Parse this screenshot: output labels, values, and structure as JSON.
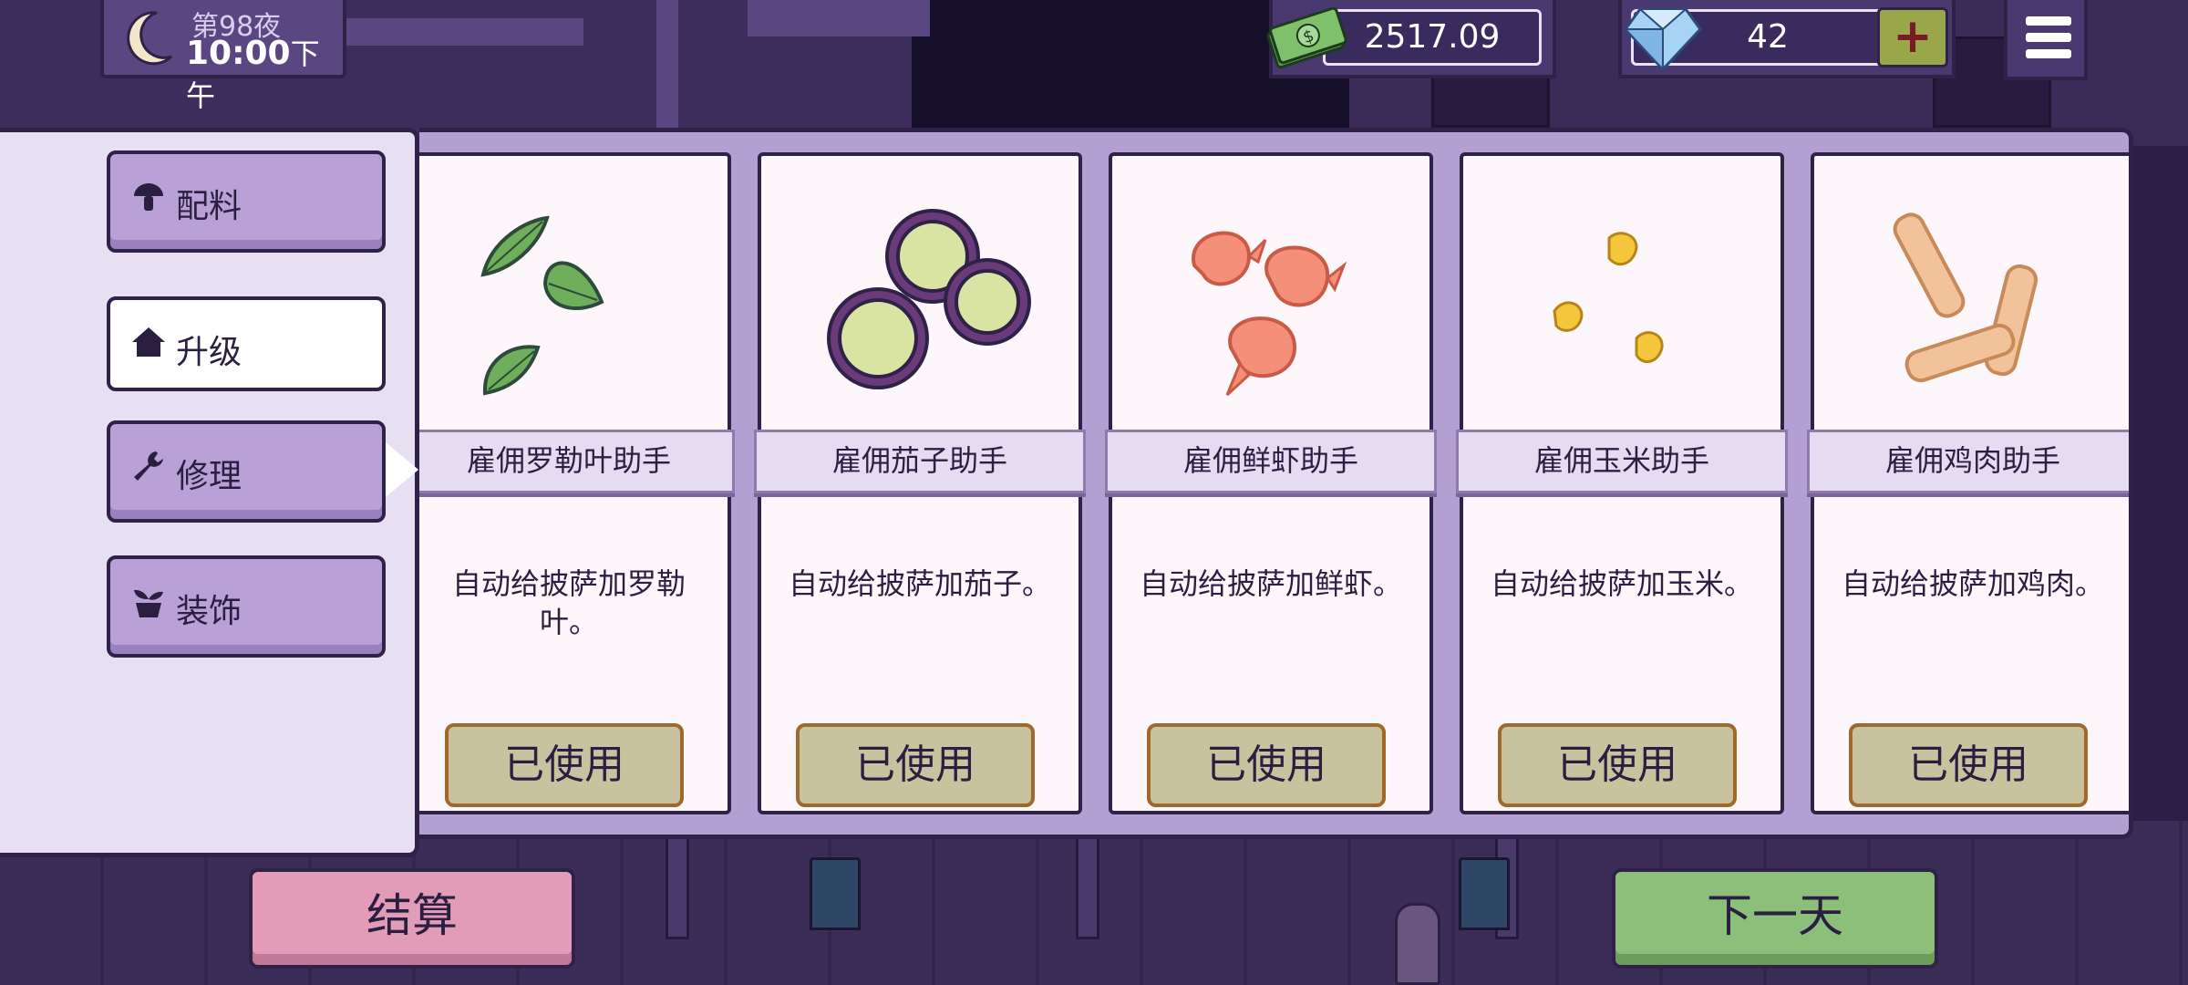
{
  "hud": {
    "night_label": "第98夜",
    "time": "10:00",
    "ampm": "下午",
    "money": "2517.09",
    "gems": "42",
    "add_gems_label": "+"
  },
  "sidebar": {
    "tabs": [
      {
        "label": "配料",
        "icon": "mushroom-icon"
      },
      {
        "label": "升级",
        "icon": "house-icon"
      },
      {
        "label": "修理",
        "icon": "wrench-icon"
      },
      {
        "label": "装饰",
        "icon": "plant-icon"
      }
    ],
    "active_tab": "升级"
  },
  "cards": [
    {
      "title": "雇佣罗勒叶助手",
      "desc": "自动给披萨加罗勒叶。",
      "button": "已使用",
      "icon": "basil-icon"
    },
    {
      "title": "雇佣茄子助手",
      "desc": "自动给披萨加茄子。",
      "button": "已使用",
      "icon": "eggplant-icon"
    },
    {
      "title": "雇佣鲜虾助手",
      "desc": "自动给披萨加鲜虾。",
      "button": "已使用",
      "icon": "shrimp-icon"
    },
    {
      "title": "雇佣玉米助手",
      "desc": "自动给披萨加玉米。",
      "button": "已使用",
      "icon": "corn-icon"
    },
    {
      "title": "雇佣鸡肉助手",
      "desc": "自动给披萨加鸡肉。",
      "button": "已使用",
      "icon": "chicken-icon"
    }
  ],
  "footer": {
    "checkout_label": "结算",
    "next_day_label": "下一天"
  },
  "colors": {
    "panel_purple": "#b39fd1",
    "tab_purple": "#b9a0d6",
    "checkout_pink": "#e29cb8",
    "next_day_green": "#8bbf7a",
    "used_button": "#c8c29e"
  }
}
